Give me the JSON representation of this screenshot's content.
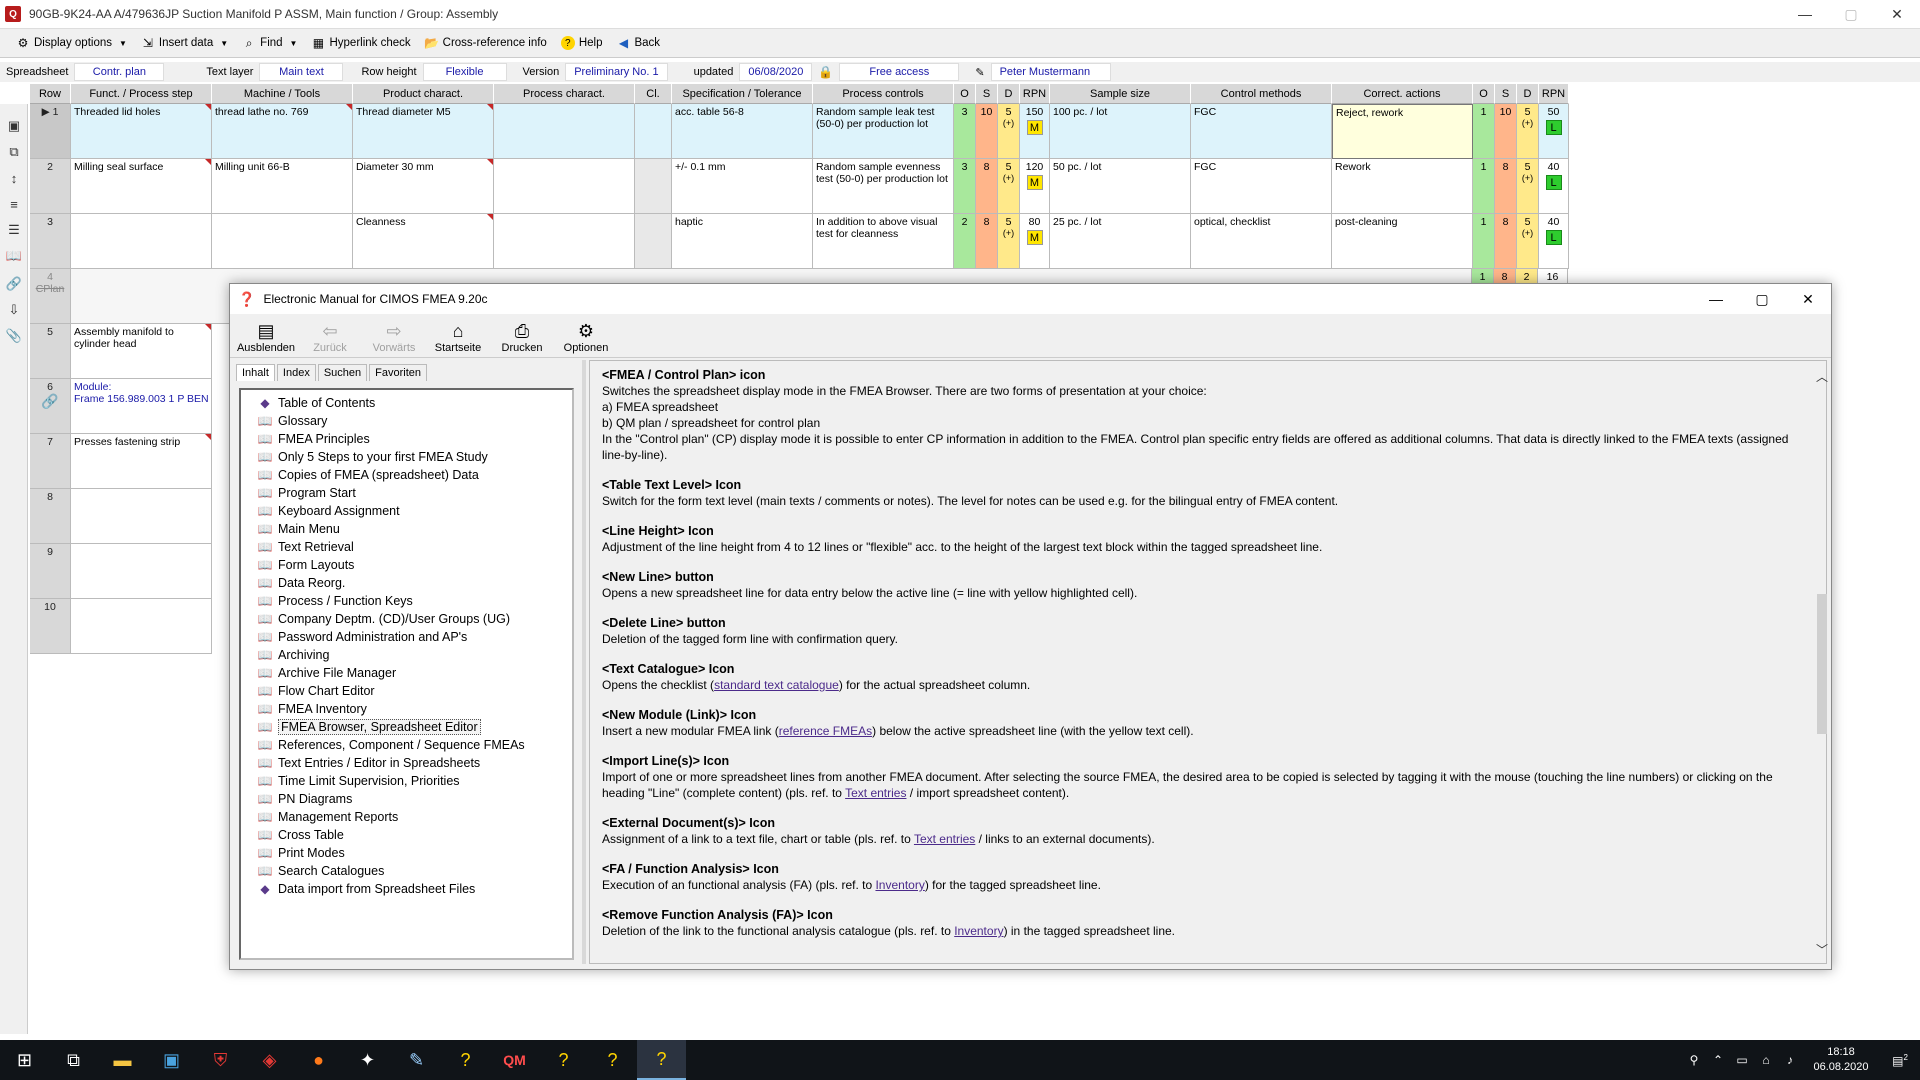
{
  "window": {
    "title": "90GB-9K24-AA  A/479636JP  Suction Manifold  P  ASSM,  Main function / Group: Assembly",
    "controls": [
      "—",
      "▢",
      "✕"
    ]
  },
  "toolbar": {
    "display_options": "Display options",
    "insert_data": "Insert data",
    "find": "Find",
    "hyperlink_check": "Hyperlink check",
    "cross_reference": "Cross-reference info",
    "help": "Help",
    "back": "Back"
  },
  "infobar": {
    "spreadsheet_label": "Spreadsheet",
    "spreadsheet_value": "Contr. plan",
    "text_layer_label": "Text layer",
    "text_layer_value": "Main text",
    "row_height_label": "Row height",
    "row_height_value": "Flexible",
    "version_label": "Version",
    "version_value": "Preliminary No. 1",
    "updated_label": "updated",
    "updated_value": "06/08/2020",
    "access_value": "Free access",
    "user_value": "Peter Mustermann"
  },
  "sheet": {
    "headers": {
      "row": "Row",
      "funct": "Funct. / Process step",
      "machine": "Machine / Tools",
      "product": "Product charact.",
      "process": "Process charact.",
      "cl": "Cl.",
      "spec": "Specification / Tolerance",
      "controls": "Process controls",
      "o": "O",
      "s": "S",
      "d": "D",
      "rpn": "RPN",
      "sample": "Sample size",
      "methods": "Control methods",
      "correct": "Correct. actions",
      "o2": "O",
      "s2": "S",
      "d2": "D",
      "rpn2": "RPN"
    },
    "rows": [
      {
        "num": "1",
        "funct": "Threaded lid holes",
        "machine": "thread lathe no. 769",
        "product": "Thread diameter M5",
        "spec": "acc. table 56-8",
        "controls": "Random sample leak test (50-0) per production lot",
        "o": "3",
        "s": "10",
        "d": "5",
        "dplus": "(+)",
        "rpn": "150",
        "badge": "M",
        "sample": "100 pc. / lot",
        "methods": "FGC",
        "correct": "Reject, rework",
        "o2": "1",
        "s2": "10",
        "d2": "5",
        "dplus2": "(+)",
        "rpn2": "50",
        "badge2": "L"
      },
      {
        "num": "2",
        "funct": "Milling seal surface",
        "machine": "Milling unit 66-B",
        "product": "Diameter 30 mm",
        "spec": "+/- 0.1 mm",
        "controls": "Random sample evenness test (50-0) per production lot",
        "o": "3",
        "s": "8",
        "d": "5",
        "dplus": "(+)",
        "rpn": "120",
        "badge": "M",
        "sample": "50 pc. / lot",
        "methods": "FGC",
        "correct": "Rework",
        "o2": "1",
        "s2": "8",
        "d2": "5",
        "dplus2": "(+)",
        "rpn2": "40",
        "badge2": "L"
      },
      {
        "num": "3",
        "funct": "",
        "machine": "",
        "product": "Cleanness",
        "spec": "haptic",
        "controls": "In addition to above visual test for cleanness",
        "o": "2",
        "s": "8",
        "d": "5",
        "dplus": "(+)",
        "rpn": "80",
        "badge": "M",
        "sample": "25 pc. / lot",
        "methods": "optical, checklist",
        "correct": "post-cleaning",
        "o2": "1",
        "s2": "8",
        "d2": "5",
        "dplus2": "(+)",
        "rpn2": "40",
        "badge2": "L"
      }
    ],
    "row4": {
      "num": "4",
      "tag": "CPlan",
      "o2": "1",
      "s2": "8",
      "d2": "2",
      "rpn2": "16"
    },
    "row5": {
      "num": "5",
      "funct": "Assembly manifold to cylinder head"
    },
    "row6": {
      "num": "6",
      "module_label": "Module:",
      "module_value": "Frame    156.989.003    1    P    BEN"
    },
    "row7": {
      "num": "7",
      "funct": "Presses fastening strip"
    },
    "row8": {
      "num": "8"
    },
    "row9": {
      "num": "9"
    },
    "row10": {
      "num": "10"
    }
  },
  "help": {
    "title": "Electronic Manual for CIMOS FMEA 9.20c",
    "buttons": {
      "hide": "Ausblenden",
      "back": "Zurück",
      "forward": "Vorwärts",
      "home": "Startseite",
      "print": "Drucken",
      "options": "Optionen"
    },
    "tabs": {
      "contents": "Inhalt",
      "index": "Index",
      "search": "Suchen",
      "favorites": "Favoriten"
    },
    "toc": [
      "Table of Contents",
      "Glossary",
      "FMEA Principles",
      "Only 5 Steps to your first FMEA Study",
      "Copies of FMEA (spreadsheet) Data",
      "Program Start",
      "Keyboard Assignment",
      "Main Menu",
      "Text Retrieval",
      "Form Layouts",
      "Data Reorg.",
      "Process / Function Keys",
      "Company Deptm. (CD)/User Groups (UG)",
      "Password Administration and AP's",
      "Archiving",
      "Archive File Manager",
      "Flow Chart Editor",
      "FMEA Inventory",
      "FMEA Browser, Spreadsheet Editor",
      "References, Component / Sequence FMEAs",
      "Text Entries / Editor in Spreadsheets",
      "Time Limit Supervision, Priorities",
      "PN  Diagrams",
      "Management Reports",
      "Cross Table",
      "Print Modes",
      "Search Catalogues",
      "Data import from Spreadsheet Files"
    ],
    "content": {
      "s1_title": "<FMEA / Control Plan> icon",
      "s1_l1": "Switches the spreadsheet display mode in the FMEA Browser. There are two forms of presentation at your choice:",
      "s1_l2": "a) FMEA spreadsheet",
      "s1_l3": "b) QM plan / spreadsheet for control plan",
      "s1_l4": "In the \"Control plan\" (CP) display mode it is possible to enter CP information in addition to the FMEA. Control plan specific entry fields are offered as additional columns. That data is directly linked to the FMEA texts (assigned line-by-line).",
      "s2_title": "<Table Text Level> Icon",
      "s2_l1": "Switch for the form text level (main texts / comments or notes). The level for notes can be used e.g. for the bilingual entry of FMEA content.",
      "s3_title": "<Line Height> Icon",
      "s3_l1": "Adjustment of the line height from 4 to 12 lines or \"flexible\" acc. to the height of the largest text block within the tagged spreadsheet line.",
      "s4_title": "<New Line> button",
      "s4_l1": "Opens a new spreadsheet line for data entry below the active line (= line with yellow highlighted cell).",
      "s5_title": "<Delete Line> button",
      "s5_l1": "Deletion of the tagged form line with confirmation query.",
      "s6_title": "<Text Catalogue> Icon",
      "s6_pre": "Opens the checklist (",
      "s6_link": "standard text catalogue",
      "s6_post": ") for the actual spreadsheet column.",
      "s7_title": "<New Module (Link)> Icon",
      "s7_pre": "Insert a new modular FMEA link (",
      "s7_link": "reference FMEAs",
      "s7_post": ") below the active spreadsheet line (with the yellow text cell).",
      "s8_title": "<Import Line(s)> Icon",
      "s8_pre": "Import of one or more spreadsheet lines from another FMEA document. After selecting the source FMEA, the desired area to be copied is selected by tagging it with the mouse (touching the line numbers) or clicking on the heading \"Line\" (complete content) (pls. ref. to ",
      "s8_link": "Text entries",
      "s8_post": " / import spreadsheet content).",
      "s9_title": "<External Document(s)> Icon",
      "s9_pre": "Assignment of a link to a text file, chart or table (pls. ref. to ",
      "s9_link": "Text entries",
      "s9_post": " / links to an external documents).",
      "s10_title": "<FA / Function Analysis> Icon",
      "s10_pre": "Execution of an functional analysis (FA) (pls. ref. to ",
      "s10_link": "Inventory",
      "s10_post": ") for the tagged spreadsheet line.",
      "s11_title": "<Remove Function Analysis (FA)> Icon",
      "s11_pre": "Deletion of the link to the functional analysis catalogue (pls. ref. to ",
      "s11_link": "Inventory",
      "s11_post": ") in the tagged spreadsheet line."
    }
  },
  "taskbar": {
    "time": "18:18",
    "date": "06.08.2020",
    "notification_count": "2"
  },
  "colors": {
    "occurrence": "#a8e89c",
    "severity": "#ffb58a",
    "detection": "#ffe98a",
    "badge_m": "#ffe600",
    "badge_l": "#2ecc2e"
  }
}
